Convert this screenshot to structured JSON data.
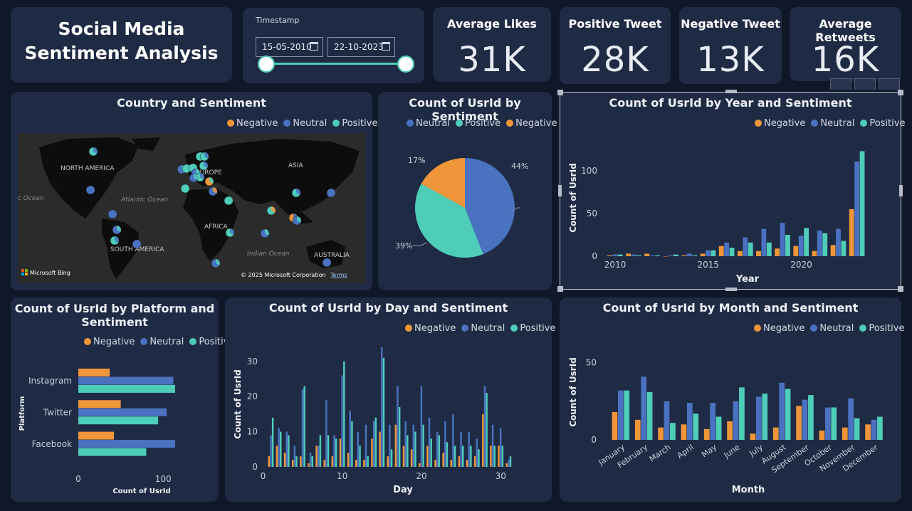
{
  "title": {
    "line1": "Social Media",
    "line2": "Sentiment Analysis"
  },
  "slicer": {
    "label": "Timestamp",
    "start": "15-05-2010",
    "end": "22-10-2023"
  },
  "kpis": [
    {
      "title": "Average Likes",
      "value": "31K"
    },
    {
      "title": "Positive Tweet",
      "value": "28K"
    },
    {
      "title": "Negative Tweet",
      "value": "13K"
    },
    {
      "title": "Average Retweets",
      "value": "16K"
    }
  ],
  "colors": {
    "negative": "#f0963a",
    "neutral": "#4a72c0",
    "positive": "#4ecdb9"
  },
  "legend_labels": {
    "negative": "Negative",
    "neutral": "Neutral",
    "positive": "Positive"
  },
  "map": {
    "title": "Country and Sentiment",
    "labels": {
      "na": "NORTH AMERICA",
      "eu": "EUROPE",
      "asia": "ASIA",
      "africa": "AFRICA",
      "sa": "SOUTH AMERICA",
      "aus": "AUSTRALIA",
      "atl": "Atlantic Ocean",
      "ind": "Indian Ocean",
      "pac": "c Ocean"
    },
    "bing": "Microsoft Bing",
    "copyright": "© 2025 Microsoft Corporation",
    "terms": "Terms"
  },
  "pie": {
    "title": "Count of UsrId by Sentiment",
    "labels": {
      "neutral": "44%",
      "positive": "39%",
      "negative": "17%"
    }
  },
  "year_chart": {
    "title": "Count of UsrId by Year and Sentiment",
    "xlabel": "Year",
    "ylabel": "Count of UsrId",
    "yticks": [
      "0",
      "50",
      "100"
    ],
    "xticks": [
      "2010",
      "2015",
      "2020"
    ]
  },
  "platform_chart": {
    "title_line1": "Count of UsrId by Platform and",
    "title_line2": "Sentiment",
    "xlabel": "Count of UsrId",
    "ylabel": "Platform",
    "xticks": [
      "0",
      "100"
    ]
  },
  "day_chart": {
    "title": "Count of UsrId by Day and Sentiment",
    "xlabel": "Day",
    "ylabel": "Count of UsrId",
    "yticks": [
      "0",
      "10",
      "20",
      "30"
    ],
    "xticks": [
      "0",
      "10",
      "20",
      "30"
    ]
  },
  "month_chart": {
    "title": "Count of UsrId by Month and Sentiment",
    "xlabel": "Month",
    "ylabel": "Count of UsrId",
    "yticks": [
      "0",
      "50"
    ]
  },
  "chart_data": [
    {
      "type": "pie",
      "title": "Count of UsrId by Sentiment",
      "slices": [
        {
          "name": "Neutral",
          "value": 44
        },
        {
          "name": "Positive",
          "value": 39
        },
        {
          "name": "Negative",
          "value": 17
        }
      ]
    },
    {
      "type": "bar",
      "title": "Count of UsrId by Year and Sentiment",
      "xlabel": "Year",
      "ylabel": "Count of UsrId",
      "ylim": [
        0,
        125
      ],
      "categories": [
        2010,
        2011,
        2012,
        2013,
        2014,
        2015,
        2016,
        2017,
        2018,
        2019,
        2020,
        2021,
        2022,
        2023
      ],
      "series": [
        {
          "name": "Negative",
          "values": [
            1,
            3,
            3,
            0,
            1,
            3,
            12,
            6,
            6,
            9,
            12,
            6,
            13,
            55
          ]
        },
        {
          "name": "Neutral",
          "values": [
            2,
            2,
            1,
            1,
            3,
            7,
            16,
            22,
            32,
            39,
            24,
            30,
            32,
            111
          ]
        },
        {
          "name": "Positive",
          "values": [
            2,
            1,
            1,
            2,
            1,
            7,
            10,
            16,
            16,
            25,
            33,
            27,
            18,
            123
          ]
        }
      ]
    },
    {
      "type": "bar",
      "title": "Count of UsrId by Platform and Sentiment",
      "xlabel": "Count of UsrId",
      "ylabel": "Platform",
      "xlim": [
        0,
        130
      ],
      "categories": [
        "Instagram",
        "Twitter",
        "Facebook"
      ],
      "series": [
        {
          "name": "Negative",
          "values": [
            37,
            50,
            42
          ]
        },
        {
          "name": "Neutral",
          "values": [
            112,
            104,
            114
          ]
        },
        {
          "name": "Positive",
          "values": [
            114,
            94,
            80
          ]
        }
      ]
    },
    {
      "type": "bar",
      "title": "Count of UsrId by Day and Sentiment",
      "xlabel": "Day",
      "ylabel": "Count of UsrId",
      "ylim": [
        0,
        34
      ],
      "categories": [
        1,
        2,
        3,
        4,
        5,
        6,
        7,
        8,
        9,
        10,
        11,
        12,
        13,
        14,
        15,
        16,
        17,
        18,
        19,
        20,
        21,
        22,
        23,
        24,
        25,
        26,
        27,
        28,
        29,
        30,
        31
      ],
      "series": [
        {
          "name": "Negative",
          "values": [
            3,
            6,
            4,
            2,
            3,
            1,
            6,
            2,
            3,
            8,
            4,
            2,
            2,
            8,
            10,
            3,
            12,
            6,
            5,
            1,
            6,
            2,
            4,
            2,
            3,
            2,
            3,
            15,
            6,
            6,
            1
          ]
        },
        {
          "name": "Neutral",
          "values": [
            9,
            11,
            10,
            6,
            22,
            4,
            6,
            19,
            9,
            26,
            16,
            10,
            12,
            13,
            34,
            12,
            23,
            13,
            12,
            23,
            14,
            10,
            13,
            15,
            10,
            10,
            8,
            23,
            12,
            11,
            2
          ]
        },
        {
          "name": "Positive",
          "values": [
            14,
            10,
            9,
            3,
            23,
            3,
            9,
            9,
            8,
            30,
            13,
            6,
            3,
            14,
            31,
            5,
            17,
            9,
            10,
            12,
            8,
            9,
            7,
            6,
            6,
            6,
            5,
            21,
            6,
            6,
            3
          ]
        }
      ]
    },
    {
      "type": "bar",
      "title": "Count of UsrId by Month and Sentiment",
      "xlabel": "Month",
      "ylabel": "Count of UsrId",
      "ylim": [
        0,
        60
      ],
      "categories": [
        "January",
        "February",
        "March",
        "April",
        "May",
        "June",
        "July",
        "August",
        "September",
        "October",
        "November",
        "December"
      ],
      "series": [
        {
          "name": "Negative",
          "values": [
            18,
            13,
            8,
            10,
            7,
            12,
            4,
            8,
            22,
            6,
            8,
            10
          ]
        },
        {
          "name": "Neutral",
          "values": [
            32,
            41,
            25,
            24,
            24,
            25,
            28,
            37,
            26,
            21,
            27,
            13
          ]
        },
        {
          "name": "Positive",
          "values": [
            32,
            31,
            11,
            17,
            15,
            34,
            30,
            33,
            29,
            21,
            14,
            15
          ]
        }
      ]
    }
  ]
}
